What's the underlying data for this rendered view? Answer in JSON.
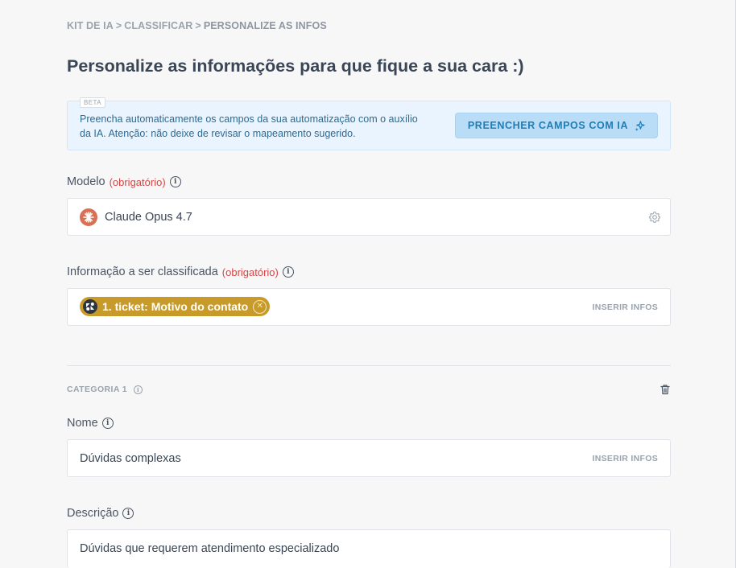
{
  "breadcrumb": {
    "items": [
      "KIT DE IA",
      "CLASSIFICAR",
      "PERSONALIZE AS INFOS"
    ],
    "separator": ">"
  },
  "page_title": "Personalize as informações para que fique a sua cara :)",
  "beta_banner": {
    "tag": "BETA",
    "text": "Preencha automaticamente os campos da sua automatização com o auxílio da IA. Atenção: não deixe de revisar o mapeamento sugerido.",
    "button_label": "PREENCHER CAMPOS COM IA",
    "button_icon": "sparkles-icon"
  },
  "modelo": {
    "label": "Modelo",
    "required": "(obrigatório)",
    "value": "Claude Opus 4.7",
    "logo_icon": "claude-logo-icon",
    "settings_icon": "gear-icon"
  },
  "informacao": {
    "label": "Informação a ser classificada",
    "required": "(obrigatório)",
    "chip_label": "1. ticket: Motivo do contato",
    "insert_label": "INSERIR INFOS"
  },
  "categoria": {
    "label": "CATEGORIA 1",
    "delete_icon": "trash-icon",
    "nome": {
      "label": "Nome",
      "value": "Dúvidas complexas",
      "insert_label": "INSERIR INFOS"
    },
    "descricao": {
      "label": "Descrição",
      "value": "Dúvidas que requerem atendimento especializado"
    }
  },
  "colors": {
    "background": "#f7f7f7",
    "banner_bg": "#eaf4fe",
    "button_bg": "#b9dcf7",
    "button_text": "#1f7db5",
    "required": "#d24646",
    "chip_bg": "#c89a2a",
    "model_logo": "#d96f54"
  }
}
